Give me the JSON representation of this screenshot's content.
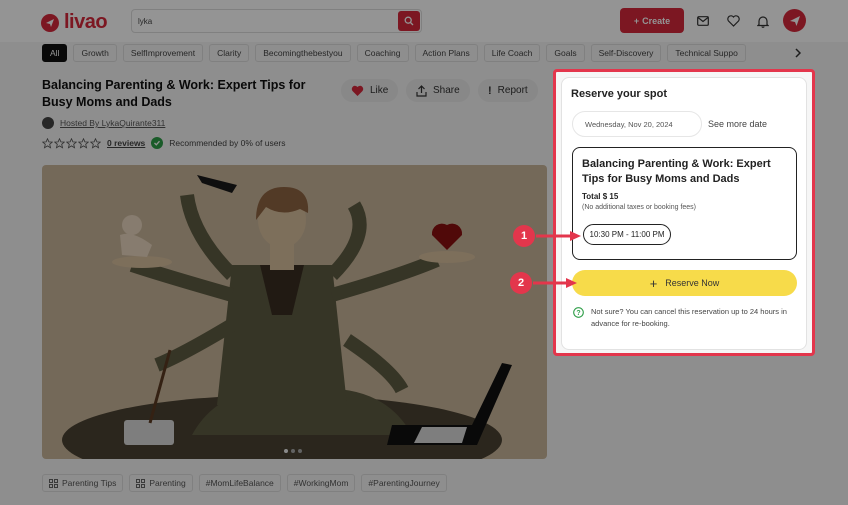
{
  "header": {
    "logo_text": "livao",
    "search_value": "lyka",
    "create_label": "Create"
  },
  "categories": [
    {
      "label": "All",
      "active": true
    },
    {
      "label": "Growth"
    },
    {
      "label": "SelfImprovement"
    },
    {
      "label": "Clarity"
    },
    {
      "label": "Becomingthebestyou"
    },
    {
      "label": "Coaching"
    },
    {
      "label": "Action Plans"
    },
    {
      "label": "Life Coach"
    },
    {
      "label": "Goals"
    },
    {
      "label": "Self-Discovery"
    },
    {
      "label": "Technical Suppo"
    }
  ],
  "event": {
    "title": "Balancing Parenting & Work: Expert Tips for Busy Moms and Dads",
    "like_label": "Like",
    "share_label": "Share",
    "report_label": "Report",
    "host": "Hosted By LykaQuirante311",
    "reviews": "0 reviews",
    "recommended": "Recommended by 0% of users",
    "rating_stars": 0,
    "max_stars": 5
  },
  "tags": [
    {
      "label": "Parenting Tips",
      "icon": "grid-icon"
    },
    {
      "label": "Parenting",
      "icon": "grid-icon"
    },
    {
      "label": "#MomLifeBalance"
    },
    {
      "label": "#WorkingMom"
    },
    {
      "label": "#ParentingJourney"
    }
  ],
  "reserve": {
    "title": "Reserve your spot",
    "date": "Wednesday, Nov 20, 2024",
    "see_more": "See more date",
    "card_title": "Balancing Parenting & Work: Expert Tips for Busy Moms and Dads",
    "total": "Total $ 15",
    "fees_note": "(No additional taxes or booking fees)",
    "time_slot": "10:30 PM - 11:00 PM",
    "reserve_label": "Reserve Now",
    "not_sure": "Not sure? You can cancel this reservation up to 24 hours in advance for re-booking."
  },
  "annotations": [
    {
      "label": "1"
    },
    {
      "label": "2"
    }
  ],
  "colors": {
    "brand": "#d6293b",
    "highlight": "#e3364c",
    "reserve_button": "#f7db4a"
  }
}
